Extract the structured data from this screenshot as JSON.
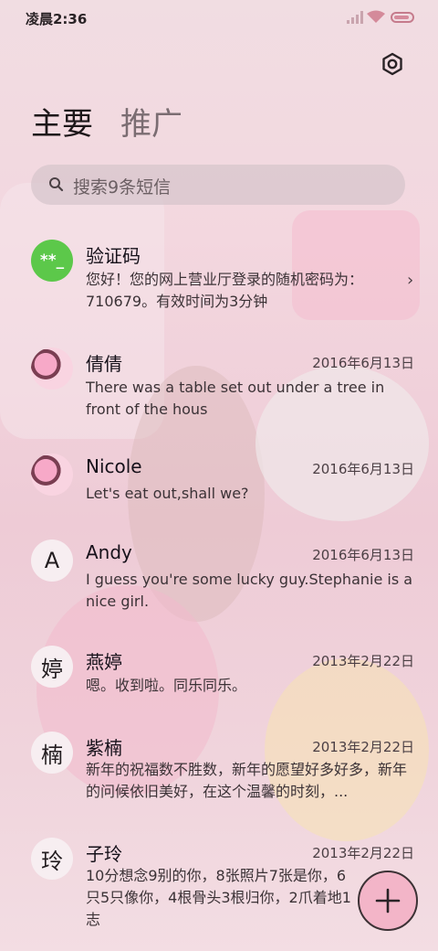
{
  "status": {
    "time": "凌晨2:36"
  },
  "tabs": [
    {
      "label": "主要",
      "active": true
    },
    {
      "label": "推广",
      "active": false
    }
  ],
  "search": {
    "placeholder": "搜索9条短信"
  },
  "conversations": [
    {
      "avatar": "**_",
      "avatar_type": "verification",
      "name": "验证码",
      "date": "",
      "preview": "您好！您的网上营业厅登录的随机密码为：710679。有效时间为3分钟"
    },
    {
      "avatar": "",
      "avatar_type": "photo",
      "name": "倩倩",
      "date": "2016年6月13日",
      "preview": "There was a table set out under a tree in front of the hous"
    },
    {
      "avatar": "",
      "avatar_type": "photo",
      "name": "Nicole",
      "date": "2016年6月13日",
      "preview": "Let's eat out,shall we?"
    },
    {
      "avatar": "A",
      "avatar_type": "letter",
      "name": "Andy",
      "date": "2016年6月13日",
      "preview": "I guess you're some lucky guy.Stephanie is a nice girl."
    },
    {
      "avatar": "婷",
      "avatar_type": "letter",
      "name": "燕婷",
      "date": "2013年2月22日",
      "preview": "嗯。收到啦。同乐同乐。"
    },
    {
      "avatar": "楠",
      "avatar_type": "letter",
      "name": "紫楠",
      "date": "2013年2月22日",
      "preview": "新年的祝福数不胜数，新年的愿望好多好多，新年的问候依旧美好，在这个温馨的时刻，..."
    },
    {
      "avatar": "玲",
      "avatar_type": "letter",
      "name": "子玲",
      "date": "2013年2月22日",
      "preview": "10分想念9别的你，8张照片7张是你，6只5只像你，4根骨头3根归你，2爪着地1志"
    }
  ],
  "colors": {
    "verification_avatar": "#5cc84a",
    "fab": "#f3b5c8"
  }
}
